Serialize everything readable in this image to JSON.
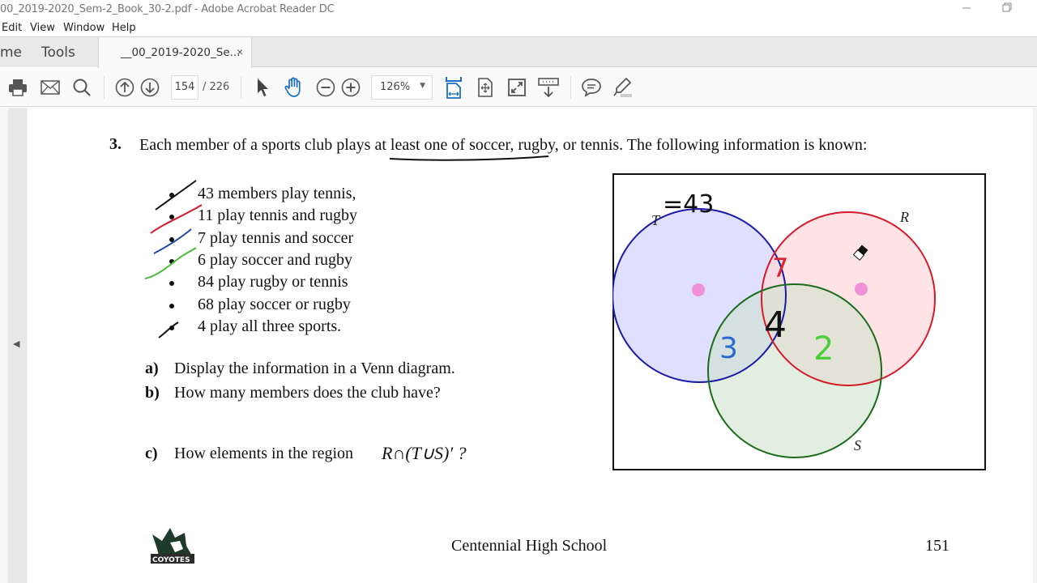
{
  "window": {
    "title": "00_2019-2020_Sem-2_Book_30-2.pdf - Adobe Acrobat Reader DC",
    "minimize_icon": "minimize-icon",
    "restore_icon": "restore-icon"
  },
  "menu": [
    "Edit",
    "View",
    "Window",
    "Help"
  ],
  "tabs": {
    "home": "me",
    "tools": "Tools",
    "document": "__00_2019-2020_Se...",
    "close": "×"
  },
  "toolbar": {
    "icons": [
      "print-icon",
      "email-icon",
      "search-icon",
      "previous-page-icon",
      "next-page-icon",
      "select-cursor-icon",
      "hand-tool-icon",
      "zoom-out-icon",
      "zoom-in-icon",
      "fit-width-icon",
      "fit-page-icon",
      "full-screen-icon",
      "scrolling-mode-icon",
      "comment-icon",
      "highlight-icon"
    ],
    "current_page": "154",
    "total_pages": "/  226",
    "zoom": "126%"
  },
  "document": {
    "question_number": "3.",
    "question_text": "Each member of a sports club plays at least one of soccer, rugby, or tennis. The following information is known:",
    "facts": [
      "43 members play tennis,",
      "11 play tennis and rugby",
      "7 play tennis and soccer",
      "6 play soccer and rugby",
      "84 play rugby or tennis",
      "68 play soccer or rugby",
      "4 play all three sports."
    ],
    "parts": [
      {
        "label": "a)",
        "text": "Display the information in a Venn diagram."
      },
      {
        "label": "b)",
        "text": "How many members does the club have?"
      },
      {
        "label": "c)",
        "text": "How elements in the region"
      }
    ],
    "region_expression": "R∩(T∪S)′ ?",
    "venn": {
      "sets": [
        {
          "label": "T",
          "color": "#1a1aa8",
          "fill": "#d9d9ff"
        },
        {
          "label": "R",
          "color": "#d41a2a",
          "fill": "#ffdede"
        },
        {
          "label": "S",
          "color": "#1a6b1a",
          "fill": "#dcebd9"
        }
      ],
      "annotations": [
        {
          "text": "=43",
          "color": "#111111",
          "region": "T total"
        },
        {
          "text": "7",
          "color": "#e0202a",
          "region": "T∩R only"
        },
        {
          "text": "4",
          "color": "#111111",
          "region": "T∩R∩S"
        },
        {
          "text": "3",
          "color": "#2a6ad0",
          "region": "T∩S only"
        },
        {
          "text": "2",
          "color": "#4ccc3a",
          "region": "R∩S only"
        }
      ]
    },
    "footer_school": "Centennial High School",
    "footer_page": "151",
    "logo": "coyotes-logo"
  }
}
